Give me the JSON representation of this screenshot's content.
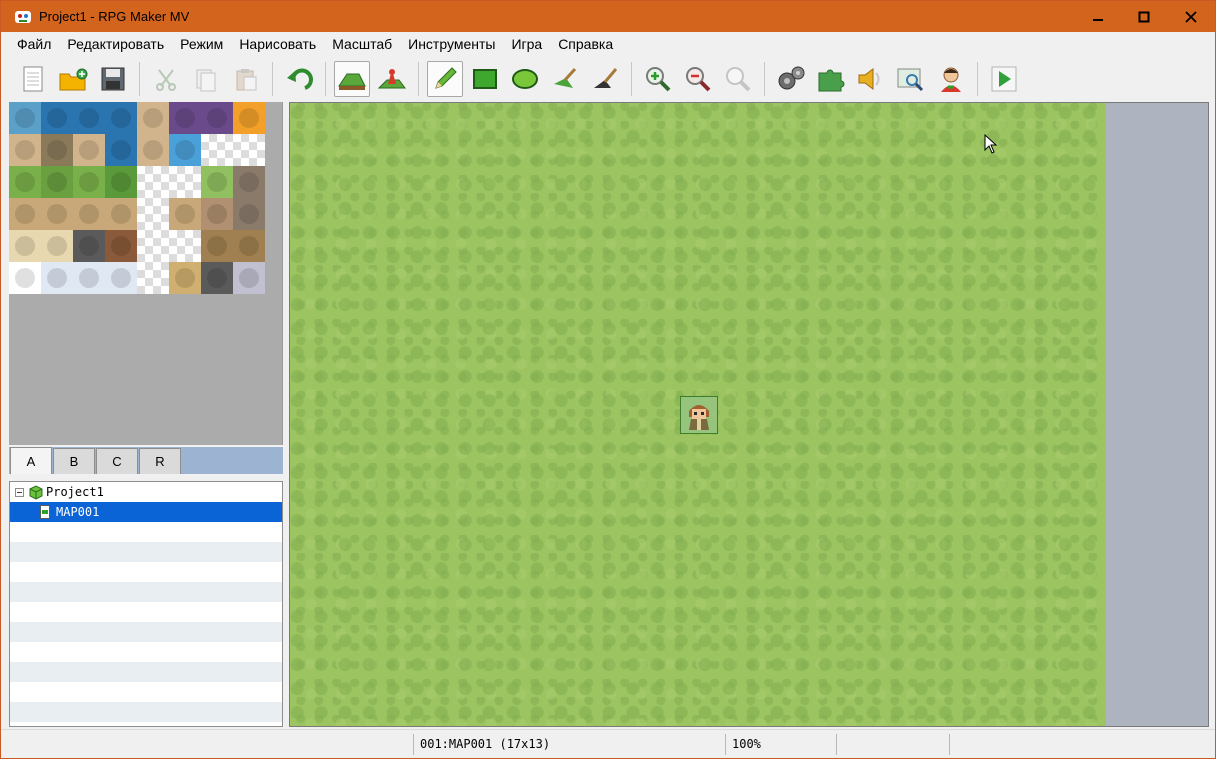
{
  "window": {
    "title": "Project1 - RPG Maker MV",
    "controls": [
      "minimize-icon",
      "maximize-icon",
      "close-icon"
    ]
  },
  "menu": {
    "items": [
      "Файл",
      "Редактировать",
      "Режим",
      "Нарисовать",
      "Масштаб",
      "Инструменты",
      "Игра",
      "Справка"
    ]
  },
  "toolbar": {
    "buttons": [
      {
        "icon": "new-project-icon",
        "enabled": true
      },
      {
        "icon": "open-project-icon",
        "enabled": true
      },
      {
        "icon": "save-project-icon",
        "enabled": true
      },
      {
        "icon": "cut-icon",
        "enabled": false
      },
      {
        "icon": "copy-icon",
        "enabled": false
      },
      {
        "icon": "paste-icon",
        "enabled": false
      },
      {
        "icon": "undo-icon",
        "enabled": true
      },
      {
        "icon": "map-mode-icon",
        "pressed": true
      },
      {
        "icon": "event-mode-icon",
        "pressed": false
      },
      {
        "icon": "pencil-icon",
        "pressed": true
      },
      {
        "icon": "rectangle-icon",
        "pressed": false
      },
      {
        "icon": "ellipse-icon",
        "pressed": false
      },
      {
        "icon": "flood-fill-icon",
        "pressed": false
      },
      {
        "icon": "shadow-pen-icon",
        "pressed": false
      },
      {
        "icon": "zoom-in-icon",
        "enabled": true
      },
      {
        "icon": "zoom-out-icon",
        "enabled": true
      },
      {
        "icon": "zoom-actual-icon",
        "enabled": false
      },
      {
        "icon": "database-icon",
        "enabled": true
      },
      {
        "icon": "plugin-manager-icon",
        "enabled": true
      },
      {
        "icon": "sound-test-icon",
        "enabled": true
      },
      {
        "icon": "event-searcher-icon",
        "enabled": true
      },
      {
        "icon": "character-generator-icon",
        "enabled": true
      },
      {
        "icon": "playtest-icon",
        "enabled": true
      }
    ]
  },
  "palette": {
    "tabs": [
      "A",
      "B",
      "C",
      "R"
    ],
    "active_tab": "A"
  },
  "tree": {
    "project": "Project1",
    "maps": [
      "MAP001"
    ],
    "selected": "MAP001"
  },
  "status": {
    "map": "001:MAP001 (17x13)",
    "zoom": "100%"
  },
  "colors": {
    "titlebar": "#d2641e",
    "selection": "#0a64d6",
    "grass": "#9cc460",
    "map_background": "#aeb4bf"
  }
}
